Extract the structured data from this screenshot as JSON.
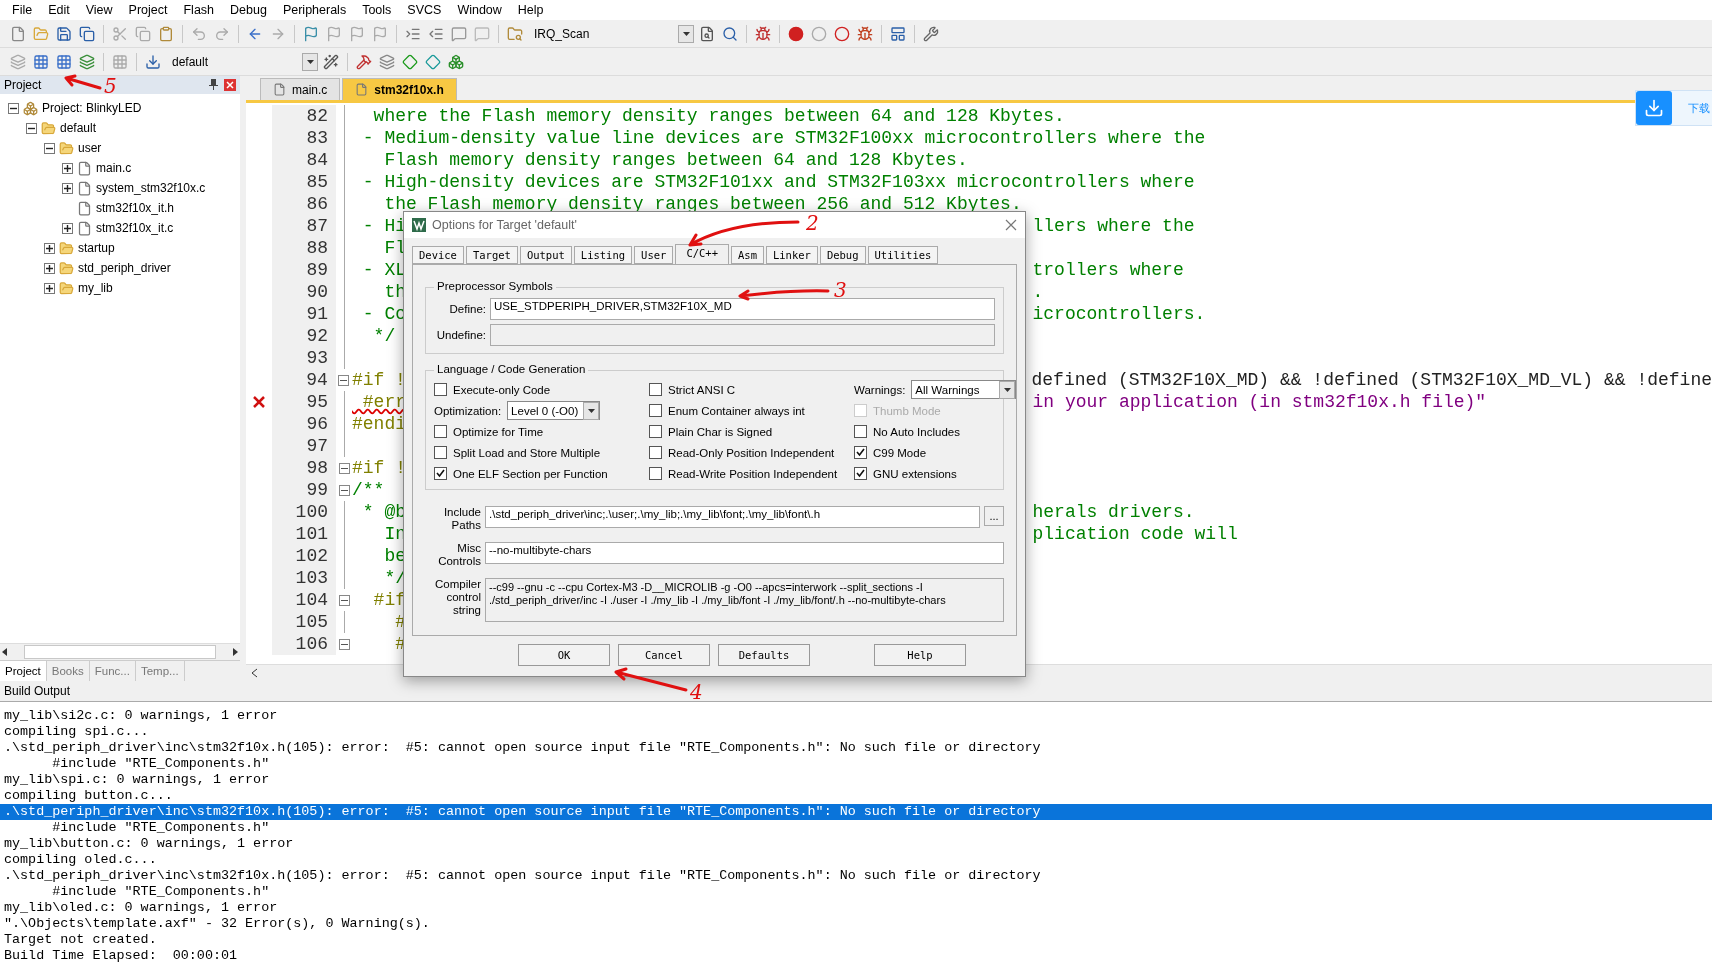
{
  "menu": [
    "File",
    "Edit",
    "View",
    "Project",
    "Flash",
    "Debug",
    "Peripherals",
    "Tools",
    "SVCS",
    "Window",
    "Help"
  ],
  "toolbar": {
    "find_combo": "IRQ_Scan",
    "target_combo": "default"
  },
  "project_panel": {
    "title": "Project",
    "tree": [
      {
        "label": "Project: BlinkyLED",
        "kind": "project",
        "expanded": true,
        "children": [
          {
            "label": "default",
            "kind": "target",
            "expanded": true,
            "children": [
              {
                "label": "user",
                "kind": "folder",
                "expanded": true,
                "children": [
                  {
                    "label": "main.c",
                    "kind": "file",
                    "expanded": false
                  },
                  {
                    "label": "system_stm32f10x.c",
                    "kind": "file",
                    "expanded": false
                  },
                  {
                    "label": "stm32f10x_it.h",
                    "kind": "file"
                  },
                  {
                    "label": "stm32f10x_it.c",
                    "kind": "file",
                    "expanded": false
                  }
                ]
              },
              {
                "label": "startup",
                "kind": "folder",
                "expanded": false
              },
              {
                "label": "std_periph_driver",
                "kind": "folder",
                "expanded": false
              },
              {
                "label": "my_lib",
                "kind": "folder",
                "expanded": false
              }
            ]
          }
        ]
      }
    ],
    "tabs": [
      {
        "label": "Project",
        "selected": true
      },
      {
        "label": "Books",
        "selected": false
      },
      {
        "label": "Func...",
        "selected": false
      },
      {
        "label": "Temp...",
        "selected": false
      }
    ]
  },
  "editor": {
    "tabs": [
      {
        "label": "main.c",
        "selected": false
      },
      {
        "label": "stm32f10x.h",
        "selected": true
      }
    ],
    "lines": [
      {
        "n": "82",
        "fold": false,
        "error": false,
        "segments": [
          {
            "text": "  where the Flash memory density ranges between 64 and 128 Kbytes.",
            "kind": "comment"
          }
        ]
      },
      {
        "n": "83",
        "fold": false,
        "error": false,
        "segments": [
          {
            "text": " - Medium-density value line devices are STM32F100xx microcontrollers where the",
            "kind": "comment"
          }
        ]
      },
      {
        "n": "84",
        "fold": false,
        "error": false,
        "segments": [
          {
            "text": "   Flash memory density ranges between 64 and 128 Kbytes.",
            "kind": "comment"
          }
        ]
      },
      {
        "n": "85",
        "fold": false,
        "error": false,
        "segments": [
          {
            "text": " - High-density devices are STM32F101xx and STM32F103xx microcontrollers where",
            "kind": "comment"
          }
        ]
      },
      {
        "n": "86",
        "fold": false,
        "error": false,
        "segments": [
          {
            "text": "   the Flash memory density ranges between 256 and 512 Kbytes.",
            "kind": "comment"
          }
        ]
      },
      {
        "n": "87",
        "fold": false,
        "error": false,
        "segments": [
          {
            "text": " - Hi",
            "kind": "comment"
          },
          {
            "text": "llers where the",
            "kind": "comment"
          }
        ]
      },
      {
        "n": "88",
        "fold": false,
        "error": false,
        "segments": [
          {
            "text": "   Fl",
            "kind": "comment"
          }
        ]
      },
      {
        "n": "89",
        "fold": false,
        "error": false,
        "segments": [
          {
            "text": " - XL",
            "kind": "comment"
          },
          {
            "text": "trollers where",
            "kind": "comment"
          }
        ]
      },
      {
        "n": "90",
        "fold": false,
        "error": false,
        "segments": [
          {
            "text": "   th",
            "kind": "comment"
          },
          {
            "text": ".",
            "kind": "comment"
          }
        ]
      },
      {
        "n": "91",
        "fold": false,
        "error": false,
        "segments": [
          {
            "text": " - Co",
            "kind": "comment"
          },
          {
            "text": "icrocontrollers.",
            "kind": "comment"
          }
        ]
      },
      {
        "n": "92",
        "fold": false,
        "error": false,
        "segments": [
          {
            "text": "  */",
            "kind": "comment"
          }
        ]
      },
      {
        "n": "93",
        "fold": false,
        "error": false
      },
      {
        "n": "94",
        "fold": true,
        "error": false,
        "segments": [
          {
            "text": "#if !",
            "kind": "directive"
          },
          {
            "text": "defined (STM32F10X_MD) && !defined (STM32F10X_MD_VL) && !define",
            "kind": "plain"
          }
        ]
      },
      {
        "n": "95",
        "fold": false,
        "error": true,
        "segments": [
          {
            "text": " #err",
            "kind": "directive"
          },
          {
            "text": "in your application (in stm32f10x.h file)\"",
            "kind": "string"
          }
        ]
      },
      {
        "n": "96",
        "fold": false,
        "error": false,
        "segments": [
          {
            "text": "#endi",
            "kind": "directive"
          }
        ]
      },
      {
        "n": "97",
        "fold": false,
        "error": false
      },
      {
        "n": "98",
        "fold": true,
        "error": false,
        "segments": [
          {
            "text": "#if !",
            "kind": "directive"
          }
        ]
      },
      {
        "n": "99",
        "fold": true,
        "error": false,
        "segments": [
          {
            "text": "/**",
            "kind": "comment"
          }
        ]
      },
      {
        "n": "100",
        "fold": false,
        "error": false,
        "segments": [
          {
            "text": " * @b",
            "kind": "comment"
          },
          {
            "text": "herals drivers.",
            "kind": "comment"
          }
        ]
      },
      {
        "n": "101",
        "fold": false,
        "error": false,
        "segments": [
          {
            "text": "   In",
            "kind": "comment"
          },
          {
            "text": "plication code will",
            "kind": "comment"
          }
        ]
      },
      {
        "n": "102",
        "fold": false,
        "error": false,
        "segments": [
          {
            "text": "   be",
            "kind": "comment"
          }
        ]
      },
      {
        "n": "103",
        "fold": false,
        "error": false,
        "segments": [
          {
            "text": "   */",
            "kind": "comment"
          }
        ]
      },
      {
        "n": "104",
        "fold": true,
        "error": false,
        "segments": [
          {
            "text": "  #if",
            "kind": "directive"
          }
        ]
      },
      {
        "n": "105",
        "fold": false,
        "error": false,
        "segments": [
          {
            "text": "    #",
            "kind": "directive"
          }
        ]
      },
      {
        "n": "106",
        "fold": true,
        "error": false,
        "segments": [
          {
            "text": "    #",
            "kind": "directive"
          }
        ]
      }
    ]
  },
  "download_widget": {
    "label": "下载"
  },
  "dialog": {
    "title": "Options for Target 'default'",
    "tabs": [
      {
        "label": "Device",
        "selected": false
      },
      {
        "label": "Target",
        "selected": false
      },
      {
        "label": "Output",
        "selected": false
      },
      {
        "label": "Listing",
        "selected": false
      },
      {
        "label": "User",
        "selected": false
      },
      {
        "label": "C/C++",
        "selected": true
      },
      {
        "label": "Asm",
        "selected": false
      },
      {
        "label": "Linker",
        "selected": false
      },
      {
        "label": "Debug",
        "selected": false
      },
      {
        "label": "Utilities",
        "selected": false
      }
    ],
    "preprocessor": {
      "title": "Preprocessor Symbols",
      "define_label": "Define:",
      "define": "USE_STDPERIPH_DRIVER,STM32F10X_MD",
      "undefine_label": "Undefine:"
    },
    "codegen": {
      "title": "Language / Code Generation",
      "columns": [
        [
          {
            "kind": "checkbox",
            "label": "Execute-only Code",
            "checked": false,
            "disabled": false
          },
          {
            "kind": "select",
            "label": "Optimization:",
            "value": "Level 0 (-O0)"
          },
          {
            "kind": "checkbox",
            "label": "Optimize for Time",
            "checked": false,
            "disabled": false
          },
          {
            "kind": "checkbox",
            "label": "Split Load and Store Multiple",
            "checked": false,
            "disabled": false
          },
          {
            "kind": "checkbox",
            "label": "One ELF Section per Function",
            "checked": true,
            "disabled": false
          }
        ],
        [
          {
            "kind": "checkbox",
            "label": "Strict ANSI C",
            "checked": false,
            "disabled": false
          },
          {
            "kind": "checkbox",
            "label": "Enum Container always int",
            "checked": false,
            "disabled": false
          },
          {
            "kind": "checkbox",
            "label": "Plain Char is Signed",
            "checked": false,
            "disabled": false
          },
          {
            "kind": "checkbox",
            "label": "Read-Only Position Independent",
            "checked": false,
            "disabled": false
          },
          {
            "kind": "checkbox",
            "label": "Read-Write Position Independent",
            "checked": false,
            "disabled": false
          }
        ],
        [
          {
            "kind": "select",
            "label": "Warnings:",
            "value": "All Warnings"
          },
          {
            "kind": "checkbox",
            "label": "Thumb Mode",
            "checked": false,
            "disabled": true
          },
          {
            "kind": "checkbox",
            "label": "No Auto Includes",
            "checked": false,
            "disabled": false
          },
          {
            "kind": "checkbox",
            "label": "C99 Mode",
            "checked": true,
            "disabled": false
          },
          {
            "kind": "checkbox",
            "label": "GNU extensions",
            "checked": true,
            "disabled": false
          }
        ]
      ]
    },
    "include_label": "Include Paths",
    "include": ".\\std_periph_driver\\inc;.\\user;.\\my_lib;.\\my_lib\\font;.\\my_lib\\font\\.h",
    "browse": "...",
    "misc_label": "Misc Controls",
    "misc": "--no-multibyte-chars",
    "compiler_label": "Compiler control string",
    "compiler": "--c99 --gnu -c --cpu Cortex-M3 -D__MICROLIB -g -O0 --apcs=interwork --split_sections -I ./std_periph_driver/inc -I ./user -I ./my_lib -I ./my_lib/font -I ./my_lib/font/.h --no-multibyte-chars",
    "buttons": [
      "OK",
      "Cancel",
      "Defaults",
      "Help"
    ]
  },
  "build_output": {
    "title": "Build Output",
    "lines": [
      {
        "text": "my_lib\\si2c.c: 0 warnings, 1 error",
        "selected": false
      },
      {
        "text": "compiling spi.c...",
        "selected": false
      },
      {
        "text": ".\\std_periph_driver\\inc\\stm32f10x.h(105): error:  #5: cannot open source input file \"RTE_Components.h\": No such file or directory",
        "selected": false
      },
      {
        "text": "      #include \"RTE_Components.h\"",
        "selected": false
      },
      {
        "text": "my_lib\\spi.c: 0 warnings, 1 error",
        "selected": false
      },
      {
        "text": "compiling button.c...",
        "selected": false
      },
      {
        "text": ".\\std_periph_driver\\inc\\stm32f10x.h(105): error:  #5: cannot open source input file \"RTE_Components.h\": No such file or directory",
        "selected": true
      },
      {
        "text": "      #include \"RTE_Components.h\"",
        "selected": false
      },
      {
        "text": "my_lib\\button.c: 0 warnings, 1 error",
        "selected": false
      },
      {
        "text": "compiling oled.c...",
        "selected": false
      },
      {
        "text": ".\\std_periph_driver\\inc\\stm32f10x.h(105): error:  #5: cannot open source input file \"RTE_Components.h\": No such file or directory",
        "selected": false
      },
      {
        "text": "      #include \"RTE_Components.h\"",
        "selected": false
      },
      {
        "text": "my_lib\\oled.c: 0 warnings, 1 error",
        "selected": false
      },
      {
        "text": "\".\\Objects\\template.axf\" - 32 Error(s), 0 Warning(s).",
        "selected": false
      },
      {
        "text": "Target not created.",
        "selected": false
      },
      {
        "text": "Build Time Elapsed:  00:00:01",
        "selected": false
      }
    ]
  },
  "annotations": [
    {
      "label": "5"
    },
    {
      "label": "2"
    },
    {
      "label": "3"
    },
    {
      "label": "4"
    }
  ]
}
